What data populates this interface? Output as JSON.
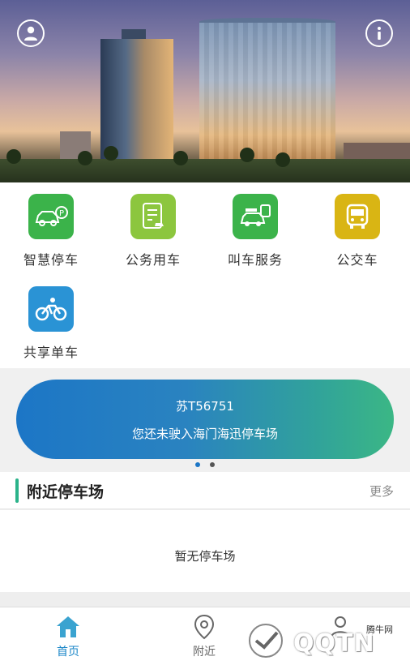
{
  "hero": {
    "profile_icon": "user-icon",
    "info_icon": "info-icon"
  },
  "services": [
    {
      "label": "智慧停车",
      "icon": "car-parking-icon",
      "color": "#3bb34a"
    },
    {
      "label": "公务用车",
      "icon": "document-car-icon",
      "color": "#8cc63e"
    },
    {
      "label": "叫车服务",
      "icon": "taxi-icon",
      "color": "#3bb34a"
    },
    {
      "label": "公交车",
      "icon": "bus-icon",
      "color": "#d9b514"
    },
    {
      "label": "共享单车",
      "icon": "bicycle-icon",
      "color": "#2a93d5"
    }
  ],
  "card": {
    "plate": "苏T56751",
    "message": "您还未驶入海门海迅停车场",
    "page_count": 2,
    "active_page": 1
  },
  "nearby": {
    "title": "附近停车场",
    "more": "更多",
    "empty": "暂无停车场"
  },
  "tabs": [
    {
      "label": "首页",
      "icon": "home-icon",
      "active": true
    },
    {
      "label": "附近",
      "icon": "location-pin-icon",
      "active": false
    },
    {
      "label": "",
      "icon": "person-icon",
      "active": false
    }
  ],
  "watermark": {
    "text": "QQTN",
    "small": "腾牛网"
  },
  "colors": {
    "accent": "#1a86c8",
    "green": "#2bb38a"
  }
}
